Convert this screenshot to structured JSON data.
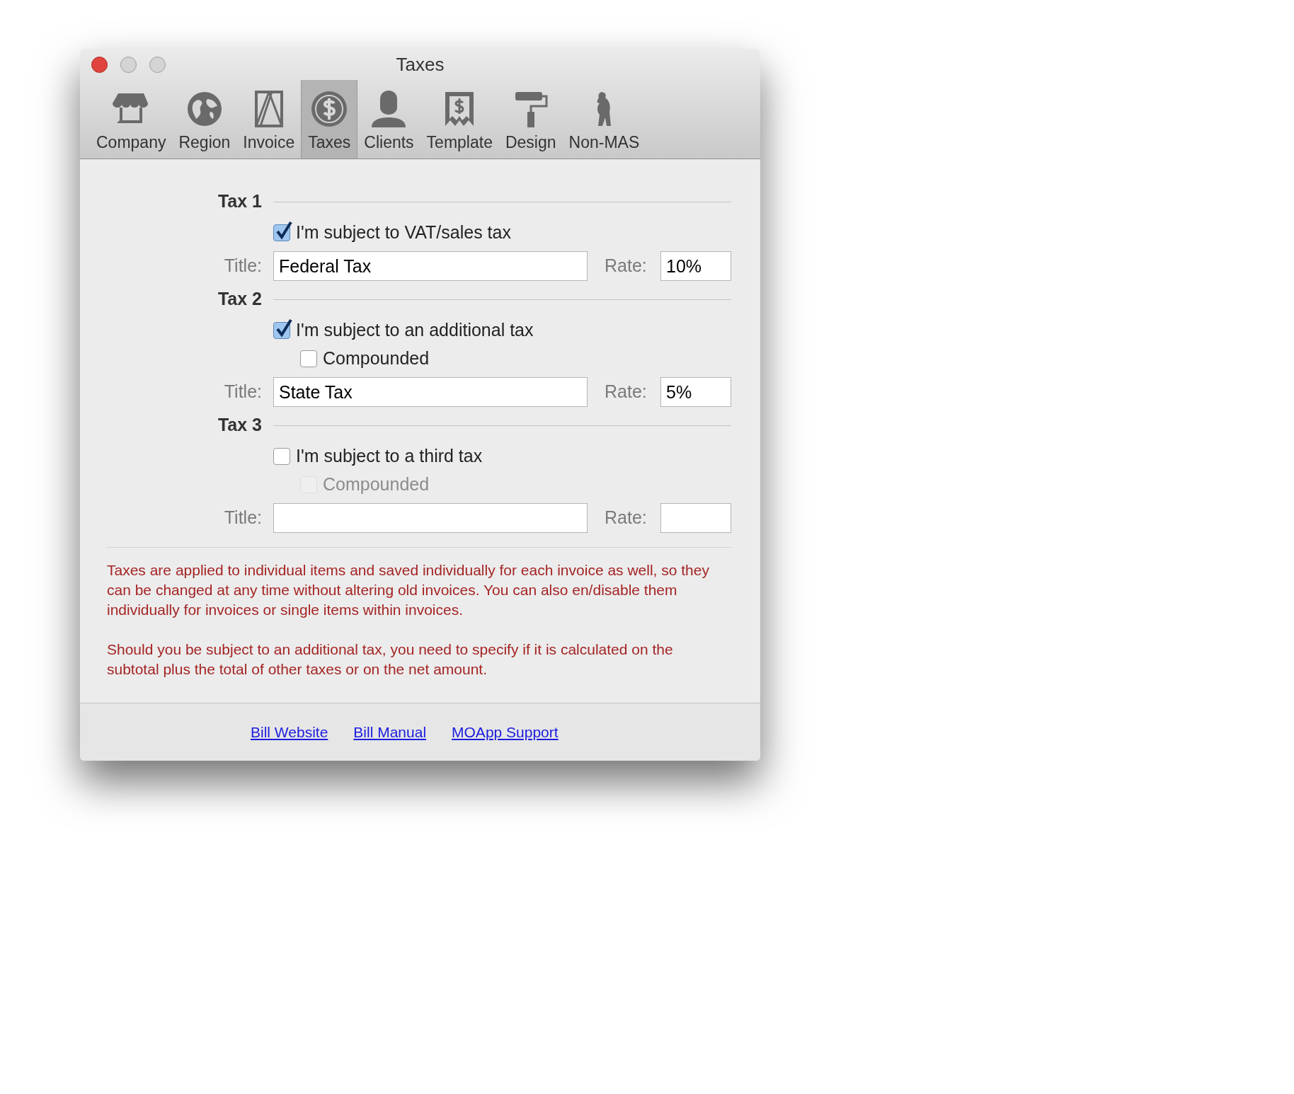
{
  "window": {
    "title": "Taxes"
  },
  "toolbar": [
    {
      "kind": "store",
      "label": "Company",
      "selected": false
    },
    {
      "kind": "globe",
      "label": "Region",
      "selected": false
    },
    {
      "kind": "document",
      "label": "Invoice",
      "selected": false
    },
    {
      "kind": "coin",
      "label": "Taxes",
      "selected": true
    },
    {
      "kind": "person",
      "label": "Clients",
      "selected": false
    },
    {
      "kind": "receipt",
      "label": "Template",
      "selected": false
    },
    {
      "kind": "roller",
      "label": "Design",
      "selected": false
    },
    {
      "kind": "figure",
      "label": "Non-MAS",
      "selected": false
    }
  ],
  "taxes": [
    {
      "heading": "Tax 1",
      "checkboxes": [
        {
          "label": "I'm subject to VAT/sales tax",
          "checked": true,
          "disabled": false,
          "indented": false
        }
      ],
      "title_label": "Title:",
      "title_value": "Federal Tax",
      "rate_label": "Rate:",
      "rate_value": "10%"
    },
    {
      "heading": "Tax 2",
      "checkboxes": [
        {
          "label": "I'm subject to an additional tax",
          "checked": true,
          "disabled": false,
          "indented": false
        },
        {
          "label": "Compounded",
          "checked": false,
          "disabled": false,
          "indented": true
        }
      ],
      "title_label": "Title:",
      "title_value": "State Tax",
      "rate_label": "Rate:",
      "rate_value": "5%"
    },
    {
      "heading": "Tax 3",
      "checkboxes": [
        {
          "label": "I'm subject to a third tax",
          "checked": false,
          "disabled": false,
          "indented": false
        },
        {
          "label": "Compounded",
          "checked": false,
          "disabled": true,
          "indented": true
        }
      ],
      "title_label": "Title:",
      "rate_label": "Rate:"
    }
  ],
  "notes": [
    "Taxes are applied to individual items and saved individually for each invoice as well, so they can be changed at any time without altering old invoices. You can also en/disable them individually for invoices or single items within invoices.",
    "Should you be subject to an additional tax, you need to specify if it is calculated on the subtotal plus the total of other taxes or on the net amount."
  ],
  "links": [
    "Bill Website",
    "Bill Manual",
    "MOApp Support"
  ]
}
